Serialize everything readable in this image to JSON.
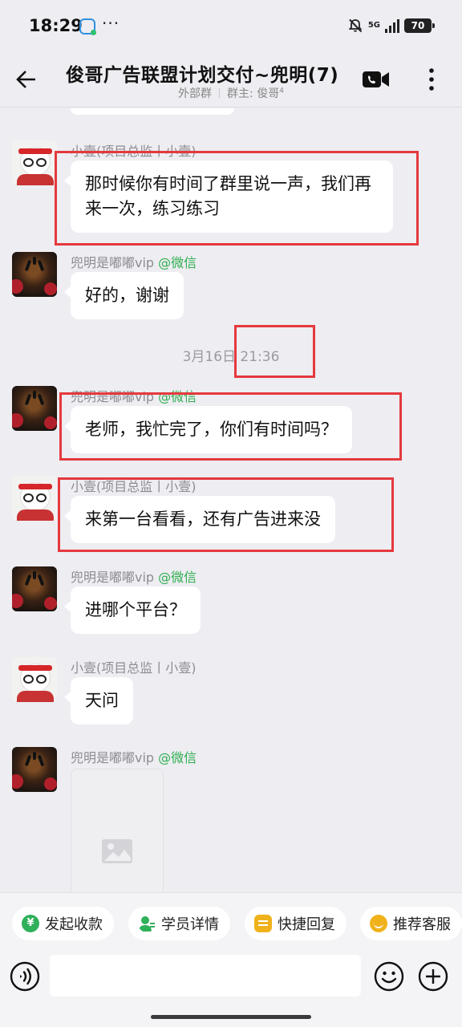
{
  "status_bar": {
    "time": "18:29",
    "dots": "···",
    "network": "5G",
    "battery": "70"
  },
  "header": {
    "title": "俊哥广告联盟计划交付~兜明(7)",
    "group_type": "外部群",
    "owner_label": "群主: 俊哥",
    "owner_mark": "4"
  },
  "messages": [
    {
      "sender": "小壹(项目总监丨小壹)",
      "sender_suffix": "",
      "avatar": "bear-avatar",
      "text": "那时候你有时间了群里说一声，我们再来一次，练习练习"
    },
    {
      "sender": "兜明是嘟嘟vip ",
      "sender_suffix": "@微信",
      "avatar": "tiger-avatar",
      "text": "好的，谢谢"
    },
    {
      "sender": "兜明是嘟嘟vip ",
      "sender_suffix": "@微信",
      "avatar": "tiger-avatar",
      "text": "老师，我忙完了，你们有时间吗？"
    },
    {
      "sender": "小壹(项目总监丨小壹)",
      "sender_suffix": "",
      "avatar": "bear-avatar",
      "text": "来第一台看看，还有广告进来没"
    },
    {
      "sender": "兜明是嘟嘟vip ",
      "sender_suffix": "@微信",
      "avatar": "tiger-avatar",
      "text": "进哪个平台？"
    },
    {
      "sender": "小壹(项目总监丨小壹)",
      "sender_suffix": "",
      "avatar": "bear-avatar",
      "text": "天问"
    },
    {
      "sender": "兜明是嘟嘟vip ",
      "sender_suffix": "@微信",
      "avatar": "tiger-avatar",
      "text": ""
    }
  ],
  "timestamp": {
    "date": "3月16日",
    "time": "21:36"
  },
  "quick_actions": [
    {
      "label": "发起收款",
      "icon": "payment-icon"
    },
    {
      "label": "学员详情",
      "icon": "user-icon"
    },
    {
      "label": "快捷回复",
      "icon": "quick-reply-icon"
    },
    {
      "label": "推荐客服",
      "icon": "service-icon"
    }
  ],
  "input": {
    "value": "",
    "placeholder": ""
  },
  "colors": {
    "background": "#EDEDF2",
    "bubble": "#FFFFFF",
    "wechat_green": "#2FAE4E",
    "annotation_red": "#E5393D"
  }
}
